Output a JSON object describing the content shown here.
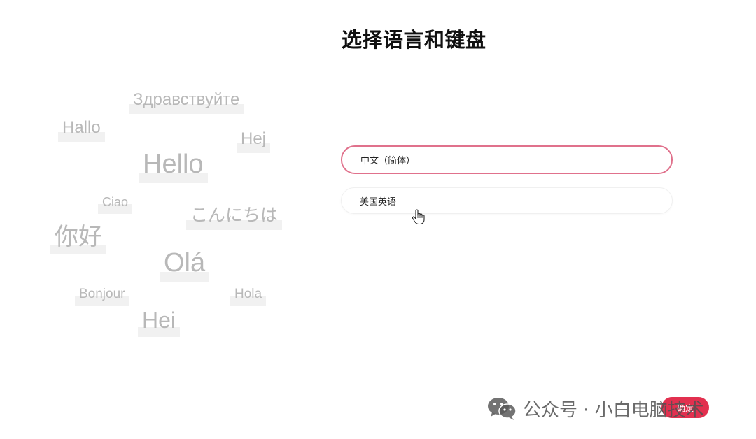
{
  "title": "选择语言和键盘",
  "greetings": {
    "zdravstvuyte": "Здравствуйте",
    "hallo": "Hallo",
    "hej": "Hej",
    "hello": "Hello",
    "ciao": "Ciao",
    "konnichiwa": "こんにちは",
    "nihao": "你好",
    "ola": "Olá",
    "bonjour": "Bonjour",
    "hola": "Hola",
    "hei": "Hei"
  },
  "options": {
    "selected": "中文（简体）",
    "second": "美国英语"
  },
  "confirm_label": "确定",
  "watermark": {
    "text": "公众号 · 小白电脑技术",
    "icon": "wechat-icon"
  },
  "colors": {
    "accent": "#e2304f",
    "selected_border": "#e0718c",
    "greeting_text": "#b8b8b8"
  }
}
